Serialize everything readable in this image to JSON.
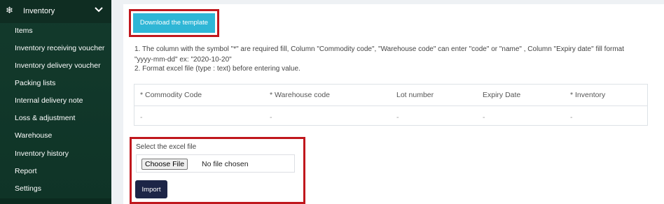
{
  "sidebar": {
    "section_label": "Inventory",
    "section_icon": "snowflake-icon",
    "items": [
      {
        "label": "Items"
      },
      {
        "label": "Inventory receiving voucher"
      },
      {
        "label": "Inventory delivery voucher"
      },
      {
        "label": "Packing lists"
      },
      {
        "label": "Internal delivery note"
      },
      {
        "label": "Loss & adjustment"
      },
      {
        "label": "Warehouse"
      },
      {
        "label": "Inventory history"
      },
      {
        "label": "Report"
      },
      {
        "label": "Settings"
      }
    ]
  },
  "main": {
    "download_button_label": "Download the template",
    "notes": [
      "1. The column with the symbol \"*\" are required fill, Column \"Commodity code\", \"Warehouse code\" can enter \"code\" or \"name\" , Column \"Expiry date\" fill format",
      "\"yyyy-mm-dd\" ex: \"2020-10-20\"",
      "2. Format excel file (type : text) before entering value."
    ],
    "table": {
      "headers": [
        "* Commodity Code",
        "* Warehouse code",
        "Lot number",
        "Expiry Date",
        "* Inventory"
      ],
      "row": [
        "-",
        "-",
        "-",
        "-",
        "-"
      ]
    },
    "select_file_label": "Select the excel file",
    "choose_file_label": "Choose File",
    "no_file_text": "No file chosen",
    "import_button_label": "Import"
  },
  "colors": {
    "sidebar_bg": "#133a2c",
    "download_button": "#2fb6d6",
    "import_button": "#1d2547",
    "highlight_border": "#c0171d"
  }
}
